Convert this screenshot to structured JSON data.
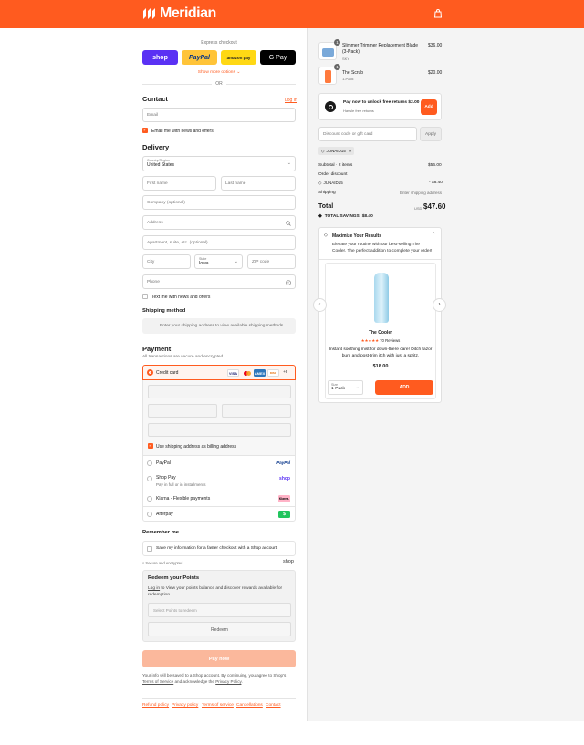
{
  "header": {
    "brand": "Meridian",
    "brand_color": "#ff5b1f",
    "cart_icon": "bag-icon"
  },
  "express": {
    "title": "Express checkout",
    "shop": "shop",
    "paypal": "PayPal",
    "amazon": "amazon pay",
    "gpay": "G Pay",
    "more": "Show more options",
    "or": "OR"
  },
  "contact": {
    "title": "Contact",
    "login": "Log in",
    "email_placeholder": "Email",
    "news": "Email me with news and offers"
  },
  "delivery": {
    "title": "Delivery",
    "country_label": "Country/Region",
    "country_value": "United States",
    "first": "First name",
    "last": "Last name",
    "company": "Company (optional)",
    "address": "Address",
    "apartment": "Apartment, suite, etc. (optional)",
    "city": "City",
    "state_label": "State",
    "state_value": "Iowa",
    "zip": "ZIP code",
    "phone": "Phone",
    "text_news": "Text me with news and offers"
  },
  "shipping": {
    "title": "Shipping method",
    "note": "Enter your shipping address to view available shipping methods."
  },
  "payment": {
    "title": "Payment",
    "subtitle": "All transactions are secure and encrypted.",
    "credit": "Credit card",
    "more_cards": "+6",
    "billing": "Use shipping address as billing address",
    "paypal": "PayPal",
    "shoppay": "Shop Pay",
    "shoppay_sub": "Pay in full or in installments",
    "klarna": "Klarna - Flexible payments",
    "afterpay": "Afterpay",
    "card_labels": {
      "visa": "VISA",
      "amex": "AMEX",
      "disc": "DISC"
    },
    "method_labels": {
      "paypal": "PayPal",
      "shop": "shop",
      "klarna": "Klarna.",
      "afterpay": "$"
    }
  },
  "remember": {
    "title": "Remember me",
    "save": "Save my information for a faster checkout with a Shop account",
    "secure": "Secure and encrypted",
    "shop": "shop"
  },
  "redeem": {
    "title": "Redeem your Points",
    "text_link": "Log in",
    "text": "to View your points balance and discover rewards available for redemption.",
    "select": "Select Points to redeem",
    "button": "Redeem"
  },
  "pay_now": "Pay now",
  "legal": {
    "t1": "Your info will be saved to a Shop account. By continuing, you agree to Shop's",
    "terms": "Terms of Service",
    "t2": "and acknowledge the",
    "privacy": "Privacy Policy",
    "end": "."
  },
  "footer": [
    "Refund policy",
    "Privacy policy",
    "Terms of service",
    "Cancellations",
    "Contact"
  ],
  "cart": {
    "items": [
      {
        "qty": "1",
        "name": "Slimmer Trimmer Replacement Blade (3-Pack)",
        "variant": "SKY",
        "price": "$36.00"
      },
      {
        "qty": "1",
        "name": "The Scrub",
        "variant": "1-Pack",
        "price": "$20.00"
      }
    ]
  },
  "upsell_banner": {
    "title": "Pay now to unlock free returns $2.00",
    "sub": "Hassle free returns",
    "button": "Add"
  },
  "discount": {
    "placeholder": "Discount code or gift card",
    "apply": "Apply",
    "code": "JUNAID15",
    "remove": "×"
  },
  "summary": {
    "subtotal_label": "Subtotal · 2 items",
    "subtotal": "$56.00",
    "order_discount": "Order discount",
    "code": "JUNAID15",
    "discount": "- $8.40",
    "shipping_label": "Shipping",
    "shipping": "Enter shipping address",
    "total_label": "Total",
    "currency": "USD",
    "total": "$47.60",
    "savings_label": "TOTAL SAVINGS",
    "savings": "$8.40"
  },
  "maximize": {
    "title": "Maximize Your Results",
    "desc": "Elevate your routine with our best-selling The Cooler. The perfect addition to complete your order!",
    "product": "The Cooler",
    "stars": "★★★★★",
    "reviews": "70 Reviews",
    "blurb": "Instant soothing mist for down-there care! Ditch razor burn and post-trim itch with just a spritz.",
    "price": "$18.00",
    "size_label": "Size",
    "size_value": "1-Pack",
    "add": "ADD"
  }
}
